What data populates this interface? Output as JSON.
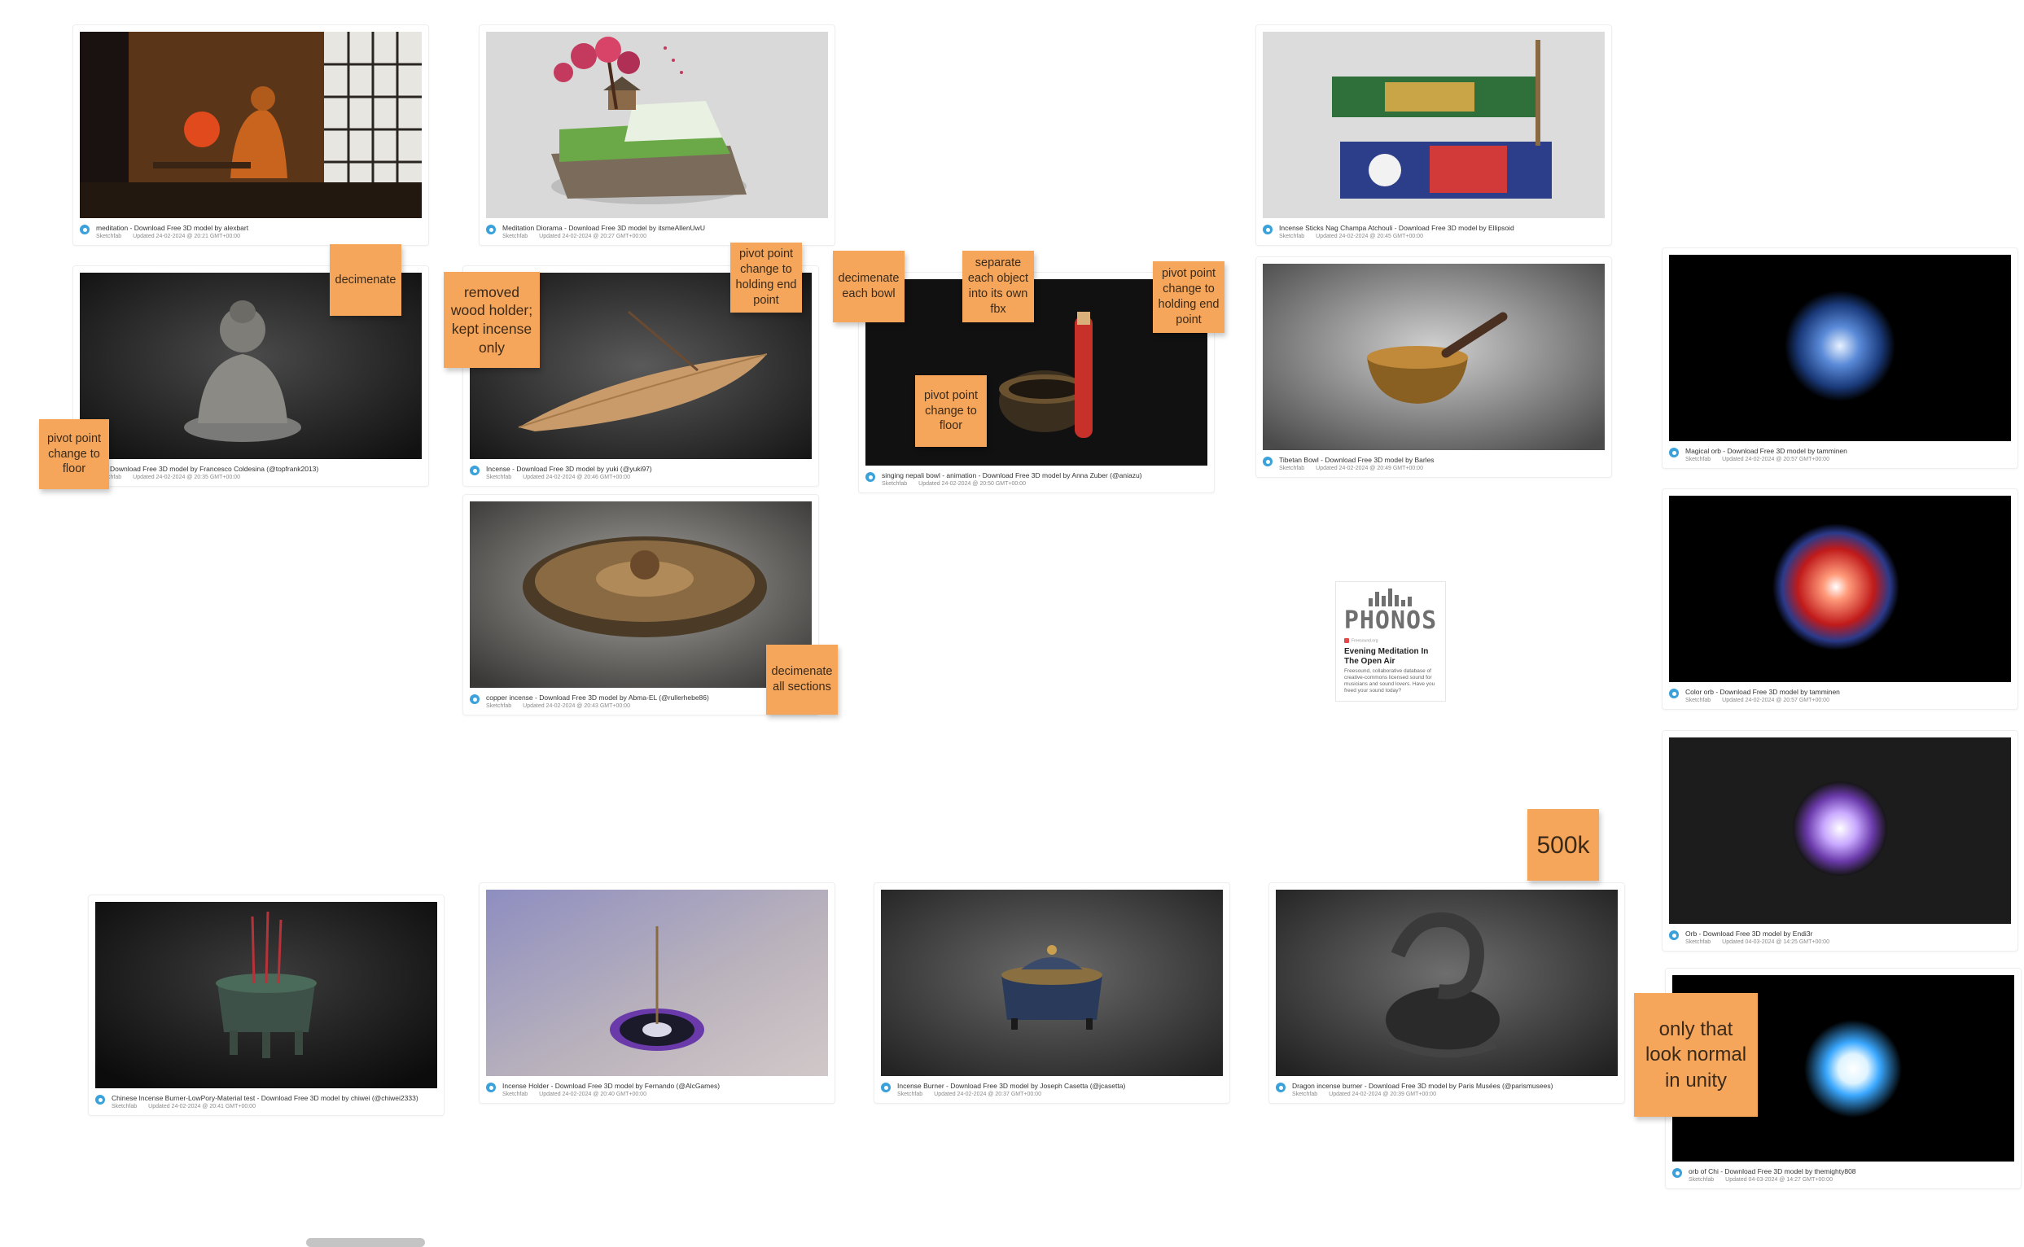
{
  "cards": [
    {
      "title": "meditation - Download Free 3D model by alexbart",
      "updated": "Updated 24-02-2024 @ 20:21 GMT+00:00",
      "site": "Sketchfab"
    },
    {
      "title": "Meditation Diorama - Download Free 3D model by itsmeAllenUwU",
      "updated": "Updated 24-02-2024 @ 20:27 GMT+00:00",
      "site": "Sketchfab"
    },
    {
      "title": "Incense Sticks Nag Champa Atchouli - Download Free 3D model by Ellipsoid",
      "updated": "Updated 24-02-2024 @ 20:45 GMT+00:00",
      "site": "Sketchfab"
    },
    {
      "title": "na - Download Free 3D model by Francesco Coldesina (@topfrank2013)",
      "updated": "Updated 24-02-2024 @ 20:35 GMT+00:00",
      "site": "Sketchfab"
    },
    {
      "title": "Incense - Download Free 3D model by yuki (@yuki97)",
      "updated": "Updated 24-02-2024 @ 20:46 GMT+00:00",
      "site": "Sketchfab"
    },
    {
      "title": "singing nepali bowl - animation - Download Free 3D model by Anna Zuber (@aniazu)",
      "updated": "Updated 24-02-2024 @ 20:50 GMT+00:00",
      "site": "Sketchfab"
    },
    {
      "title": "Tibetan Bowl - Download Free 3D model by Barles",
      "updated": "Updated 24-02-2024 @ 20:49 GMT+00:00",
      "site": "Sketchfab"
    },
    {
      "title": "Magical orb - Download Free 3D model by tamminen",
      "updated": "Updated 24-02-2024 @ 20:57 GMT+00:00",
      "site": "Sketchfab"
    },
    {
      "title": "copper incense - Download Free 3D model by Abma-EL (@rullerhebe86)",
      "updated": "Updated 24-02-2024 @ 20:43 GMT+00:00",
      "site": "Sketchfab"
    },
    {
      "title": "Color orb - Download Free 3D model by tamminen",
      "updated": "Updated 24-02-2024 @ 20:57 GMT+00:00",
      "site": "Sketchfab"
    },
    {
      "title": "Orb - Download Free 3D model by Endi3r",
      "updated": "Updated 04-03-2024 @ 14:25 GMT+00:00",
      "site": "Sketchfab"
    },
    {
      "title": "Chinese Incense Burner-LowPory-Material test - Download Free 3D model by chiwei (@chiwei2333)",
      "updated": "Updated 24-02-2024 @ 20:41 GMT+00:00",
      "site": "Sketchfab"
    },
    {
      "title": "Incense Holder - Download Free 3D model by Fernando (@AlcGames)",
      "updated": "Updated 24-02-2024 @ 20:40 GMT+00:00",
      "site": "Sketchfab"
    },
    {
      "title": "Incense Burner - Download Free 3D model by Joseph Casetta (@jcasetta)",
      "updated": "Updated 24-02-2024 @ 20:37 GMT+00:00",
      "site": "Sketchfab"
    },
    {
      "title": "Dragon incense burner - Download Free 3D model by Paris Musées (@parismusees)",
      "updated": "Updated 24-02-2024 @ 20:39 GMT+00:00",
      "site": "Sketchfab"
    },
    {
      "title": "orb of Chi - Download Free 3D model by themighty808",
      "updated": "Updated 04-03-2024 @ 14:27 GMT+00:00",
      "site": "Sketchfab"
    }
  ],
  "stickies": [
    "decimenate",
    "pivot point change to floor",
    "removed wood holder; kept incense only",
    "pivot point change to holding end point",
    "decimenate each bowl",
    "separate each object into its own fbx",
    "pivot point change to holding end point",
    "pivot point change to floor",
    "decimenate all sections",
    "500k",
    "only that look normal in unity"
  ],
  "ad": {
    "logo": "PHONOS",
    "sponsor": "Freesound.org",
    "title": "Evening Meditation In The Open Air",
    "description": "Freesound, collaborative database of creative-commons licensed sound for musicians and sound lovers. Have you freed your sound today?"
  },
  "colors": {
    "sticky": "#f5a65b",
    "favicon": "#3aa1db"
  }
}
